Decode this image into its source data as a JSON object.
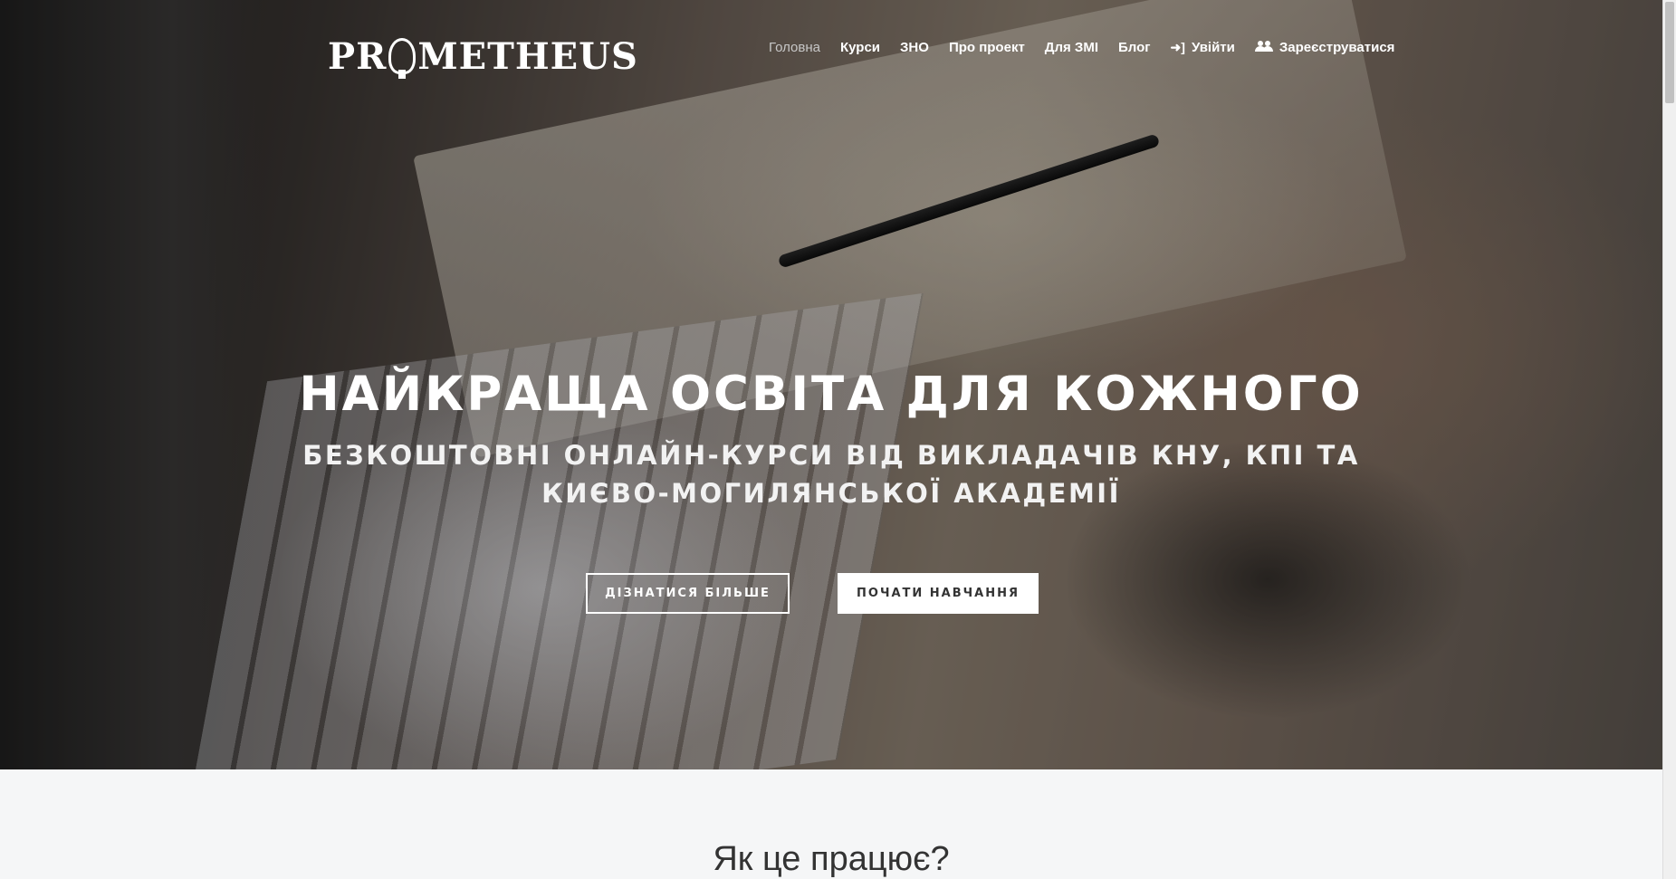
{
  "brand": {
    "logo_text_before": "PR",
    "logo_text_after": "METHEUS"
  },
  "nav": {
    "items": [
      {
        "label": "Головна",
        "active": true
      },
      {
        "label": "Курси"
      },
      {
        "label": "ЗНО"
      },
      {
        "label": "Про проект"
      },
      {
        "label": "Для ЗМІ"
      },
      {
        "label": "Блог"
      }
    ],
    "login_label": "Увійти",
    "register_label": "Зареєструватися"
  },
  "hero": {
    "headline": "НАЙКРАЩА ОСВІТА ДЛЯ КОЖНОГО",
    "subline": "БЕЗКОШТОВНІ ОНЛАЙН-КУРСИ ВІД ВИКЛАДАЧІВ КНУ, КПІ ТА КИЄВО-МОГИЛЯНСЬКОЇ АКАДЕМІЇ",
    "learn_more_label": "ДІЗНАТИСЯ БІЛЬШЕ",
    "start_label": "ПОЧАТИ НАВЧАННЯ"
  },
  "how_it_works": {
    "title": "Як це працює?"
  },
  "icons": {
    "login": "sign-in-icon",
    "register": "users-icon"
  }
}
